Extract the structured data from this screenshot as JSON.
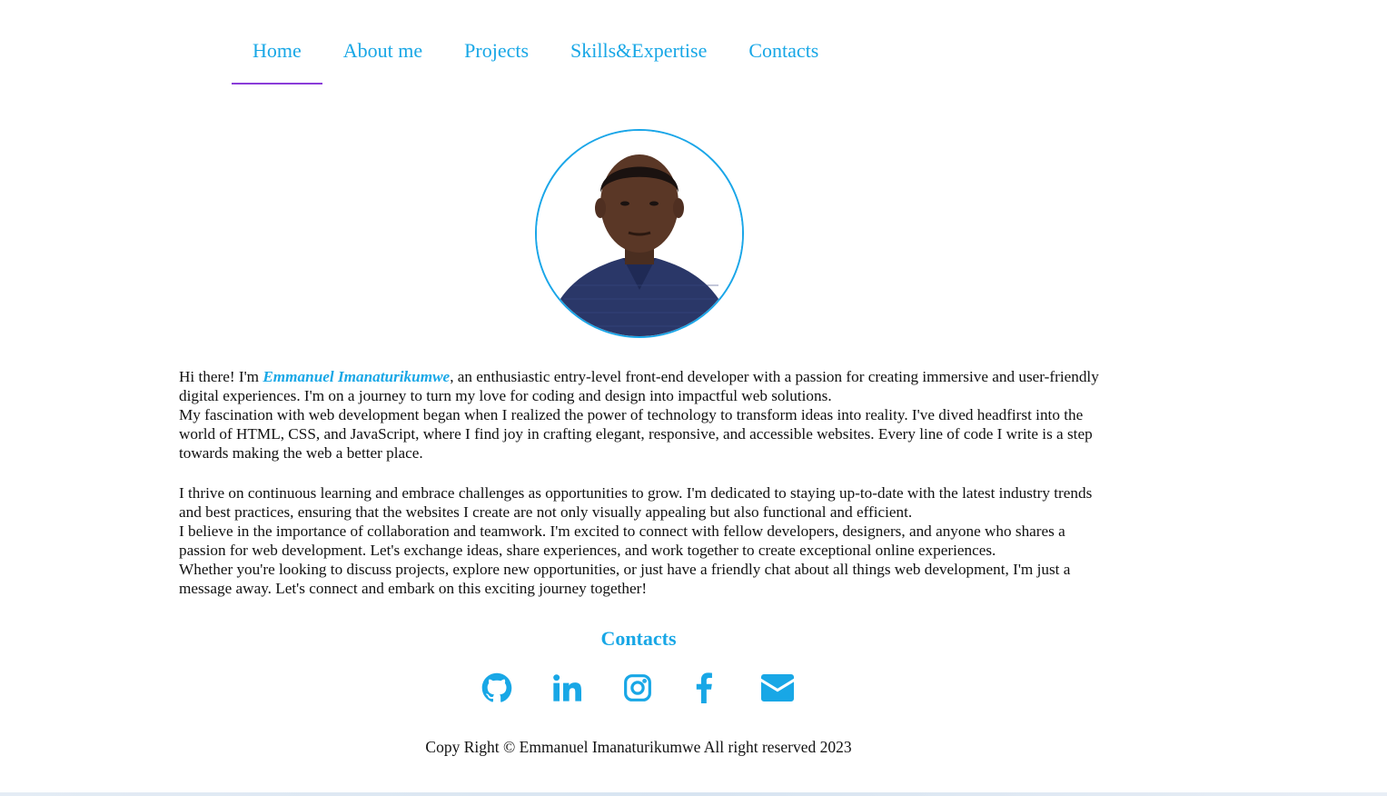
{
  "nav": {
    "items": [
      {
        "label": "Home",
        "active": true
      },
      {
        "label": "About me",
        "active": false
      },
      {
        "label": "Projects",
        "active": false
      },
      {
        "label": "Skills&Expertise",
        "active": false
      },
      {
        "label": "Contacts",
        "active": false
      }
    ]
  },
  "bio": {
    "greeting": "Hi there! I'm ",
    "name": "Emmanuel Imanaturikumwe",
    "p1_rest": ", an enthusiastic entry-level front-end developer with a passion for creating immersive and user-friendly digital experiences. I'm on a journey to turn my love for coding and design into impactful web solutions.",
    "p2": "My fascination with web development began when I realized the power of technology to transform ideas into reality. I've dived headfirst into the world of HTML, CSS, and JavaScript, where I find joy in crafting elegant, responsive, and accessible websites. Every line of code I write is a step towards making the web a better place.",
    "p3": "I thrive on continuous learning and embrace challenges as opportunities to grow. I'm dedicated to staying up-to-date with the latest industry trends and best practices, ensuring that the websites I create are not only visually appealing but also functional and efficient.",
    "p4": "I believe in the importance of collaboration and teamwork. I'm excited to connect with fellow developers, designers, and anyone who shares a passion for web development. Let's exchange ideas, share experiences, and work together to create exceptional online experiences.",
    "p5": "Whether you're looking to discuss projects, explore new opportunities, or just have a friendly chat about all things web development, I'm just a message away. Let's connect and embark on this exciting journey together!"
  },
  "contacts": {
    "title": "Contacts",
    "icons": [
      "github-icon",
      "linkedin-icon",
      "instagram-icon",
      "facebook-icon",
      "envelope-icon"
    ]
  },
  "footer": {
    "text": "Copy Right © Emmanuel Imanaturikumwe All right reserved 2023"
  },
  "colors": {
    "accent": "#18a7e6",
    "nav_underline": "#8a3cd9"
  }
}
